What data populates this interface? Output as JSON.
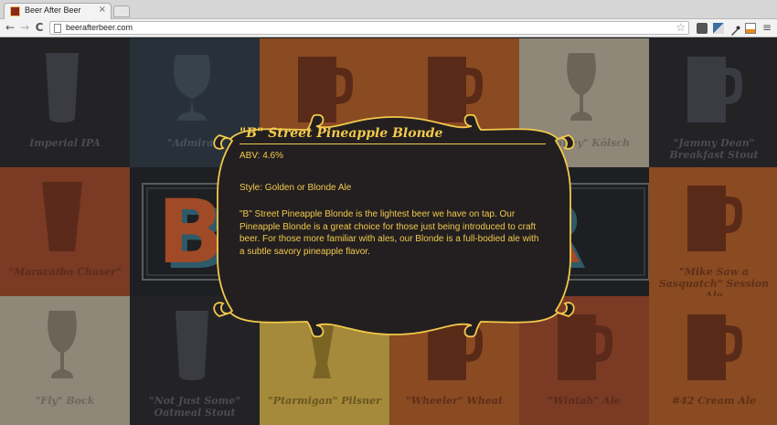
{
  "browser": {
    "tab_title": "Beer After Beer",
    "tab_close": "×",
    "back": "←",
    "forward": "→",
    "reload": "C",
    "url": "beerafterbeer.com",
    "star": "☆",
    "menu": "≡"
  },
  "tiles": [
    {
      "name": "Imperial IPA",
      "bg": "#232326",
      "fg": "#3a3c42",
      "text": "#4a4c52",
      "icon": "pint-icon"
    },
    {
      "name": "\"Admiral\"",
      "bg": "#283139",
      "fg": "#36424c",
      "text": "#48525b",
      "icon": "snifter-icon"
    },
    {
      "name": "",
      "bg": "#8a4a22",
      "fg": "#5a2a18",
      "text": "#6a3a20",
      "icon": "mug-icon"
    },
    {
      "name": "",
      "bg": "#8a4a22",
      "fg": "#5a2a18",
      "text": "#6a3a20",
      "icon": "mug-icon"
    },
    {
      "name": "\"Whitey\" Kölsch",
      "bg": "#8f8778",
      "fg": "#6b6457",
      "text": "#6e675a",
      "icon": "tulip-icon"
    },
    {
      "name": "\"Jammy Dean\" Breakfast Stout",
      "bg": "#232326",
      "fg": "#3a3c42",
      "text": "#4a4c52",
      "icon": "mug-icon"
    },
    {
      "name": "\"Maracaibo Chaser\"",
      "bg": "#7a3a24",
      "fg": "#5c2a1a",
      "text": "#5a2c1e",
      "icon": "shaker-icon"
    },
    {
      "name": "",
      "bg": "#1e1f22",
      "fg": "#2a2b2f",
      "text": "#3a3b40",
      "icon": "logo-b"
    },
    {
      "name": "",
      "bg": "#7a3a24",
      "fg": "#5c2a1a",
      "text": "#5a2c1e",
      "icon": "mug-icon"
    },
    {
      "name": "",
      "bg": "#8a4a22",
      "fg": "#5a2a18",
      "text": "#6a3a20",
      "icon": "mug-icon"
    },
    {
      "name": "",
      "bg": "#1e1f22",
      "fg": "#2a2b2f",
      "text": "#3a3b40",
      "icon": "logo-r"
    },
    {
      "name": "\"Mike Saw a Sasquatch\" Session Ale",
      "bg": "#8a4a22",
      "fg": "#5a2a18",
      "text": "#5e3018",
      "icon": "mug-icon"
    },
    {
      "name": "\"Fly\" Bock",
      "bg": "#8f8778",
      "fg": "#6b6457",
      "text": "#6e675a",
      "icon": "tulip-icon"
    },
    {
      "name": "\"Not Just Some\" Oatmeal Stout",
      "bg": "#232326",
      "fg": "#3a3c42",
      "text": "#4a4c52",
      "icon": "pint-icon"
    },
    {
      "name": "\"Ptarmigan\" Pilsner",
      "bg": "#a48a3a",
      "fg": "#7a6424",
      "text": "#6a5420",
      "icon": "pilsner-icon"
    },
    {
      "name": "\"Wheeler\" Wheat",
      "bg": "#8a4a22",
      "fg": "#5a2a18",
      "text": "#5e3018",
      "icon": "mug-icon"
    },
    {
      "name": "\"Wintah\" Ale",
      "bg": "#7a3a24",
      "fg": "#5c2a1a",
      "text": "#5a2c1e",
      "icon": "mug-icon"
    },
    {
      "name": "#42 Cream Ale",
      "bg": "#8a4a22",
      "fg": "#5a2a18",
      "text": "#5e3018",
      "icon": "mug-icon"
    }
  ],
  "logo": {
    "left_letter": "B",
    "right_letter": "R"
  },
  "modal": {
    "title": "\"B\" Street Pineapple Blonde",
    "abv": "ABV: 4.6%",
    "style": "Style: Golden or Blonde Ale",
    "description": "\"B\" Street Pineapple Blonde is the lightest beer we have on tap. Our Pineapple Blonde is a great choice for those just being introduced to craft beer. For those more familiar with ales, our Blonde is a full-bodied ale with a subtle savory pineapple flavor.",
    "accent": "#f2c94c",
    "background": "#231f20"
  }
}
